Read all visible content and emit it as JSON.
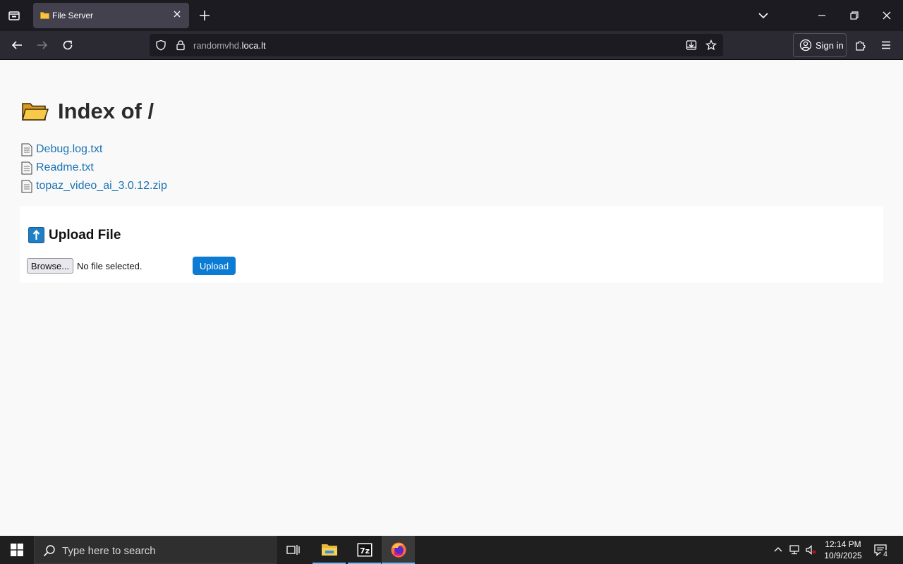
{
  "browser": {
    "tab": {
      "title": "File Server",
      "favicon": "folder-icon"
    },
    "url": {
      "host_prefix": "randomvhd.",
      "host_domain": "loca.lt"
    },
    "signin_label": "Sign in"
  },
  "page": {
    "heading": "Index of /",
    "files": [
      {
        "name": "Debug.log.txt",
        "icon": "document-icon"
      },
      {
        "name": "Readme.txt",
        "icon": "document-icon"
      },
      {
        "name": "topaz_video_ai_3.0.12.zip",
        "icon": "document-icon"
      }
    ],
    "upload": {
      "heading": "Upload File",
      "browse_label": "Browse...",
      "status": "No file selected.",
      "submit_label": "Upload"
    }
  },
  "taskbar": {
    "search_placeholder": "Type here to search",
    "clock_time": "12:14 PM",
    "clock_date": "10/9/2025",
    "notification_count": "4"
  },
  "colors": {
    "link": "#1a73b3",
    "upload_button": "#0b7bd4",
    "tabstrip_bg": "#1c1b22",
    "toolbar_bg": "#2b2a33"
  }
}
